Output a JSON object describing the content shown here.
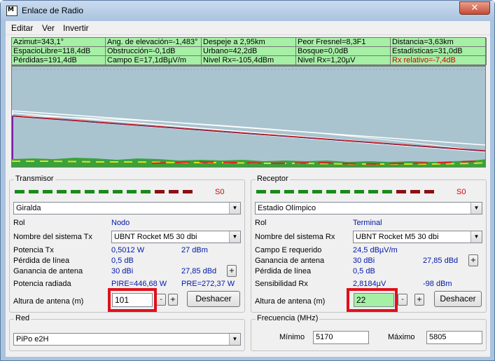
{
  "window": {
    "title": "Enlace de Radio",
    "icon_text": "M"
  },
  "menu": {
    "items": [
      "Editar",
      "Ver",
      "Invertir"
    ]
  },
  "stats": {
    "rows": [
      [
        "Azimut=343,1°",
        "Ang. de elevación=-1,483°",
        "Despeje a 2,95km",
        "Peor Fresnel=8,3F1",
        "Distancia=3,63km"
      ],
      [
        "EspacioLibre=118,4dB",
        "Obstrucción=-0,1dB",
        "Urbano=42,2dB",
        "Bosque=0,0dB",
        "Estadísticas=31,0dB"
      ],
      [
        "Pérdidas=191,4dB",
        "Campo E=17,1dBµV/m",
        "Nivel Rx=-105,4dBm",
        "Nivel Rx=1,20µV",
        "Rx relativo=-7,4dB"
      ]
    ],
    "highlight_color": "#d40000"
  },
  "transmisor": {
    "group_label": "Transmisor",
    "meter_label": "S0",
    "station": "Giralda",
    "rol_label": "Rol",
    "rol_value": "Nodo",
    "system_label": "Nombre del sistema Tx",
    "system_value": "UBNT Rocket M5 30 dbi",
    "potencia_label": "Potencia Tx",
    "potencia_w": "0,5012 W",
    "potencia_dbm": "27 dBm",
    "perdida_label": "Pérdida de línea",
    "perdida_value": "0,5 dB",
    "ganancia_label": "Ganancia de antena",
    "ganancia_dbi": "30 dBi",
    "ganancia_dbd": "27,85 dBd",
    "radiada_label": "Potencia radiada",
    "pire": "PIRE=446,68 W",
    "pre": "PRE=272,37 W",
    "altura_label": "Altura de antena (m)",
    "altura_value": "101",
    "minus": "-",
    "plus": "+",
    "undo": "Deshacer"
  },
  "receptor": {
    "group_label": "Receptor",
    "meter_label": "S0",
    "station": "Estadio Olímpico",
    "rol_label": "Rol",
    "rol_value": "Terminal",
    "system_label": "Nombre del sistema Rx",
    "system_value": "UBNT Rocket M5 30 dbi",
    "campo_label": "Campo E requerido",
    "campo_value": "24,5 dBµV/m",
    "ganancia_label": "Ganancia de antena",
    "ganancia_dbi": "30 dBi",
    "ganancia_dbd": "27,85 dBd",
    "perdida_label": "Pérdida de línea",
    "perdida_value": "0,5 dB",
    "sens_label": "Sensibilidad Rx",
    "sens_uv": "2,8184µV",
    "sens_dbm": "-98 dBm",
    "altura_label": "Altura de antena (m)",
    "altura_value": "22",
    "minus": "-",
    "plus": "+",
    "undo": "Deshacer"
  },
  "red": {
    "group_label": "Red",
    "value": "PiPo e2H"
  },
  "frecuencia": {
    "group_label": "Frecuencia (MHz)",
    "min_label": "Mínimo",
    "min_value": "5170",
    "max_label": "Máximo",
    "max_value": "5805"
  },
  "colors": {
    "stats_bg": "#a6f0a6",
    "profile_bg": "#a9c4cf",
    "highlight_box": "#e0101a",
    "value_text": "#0018a8",
    "meter_green": "#1a8a1a",
    "meter_red": "#8b1010"
  },
  "meter": {
    "green_segments": 10,
    "red_segments": 3
  }
}
